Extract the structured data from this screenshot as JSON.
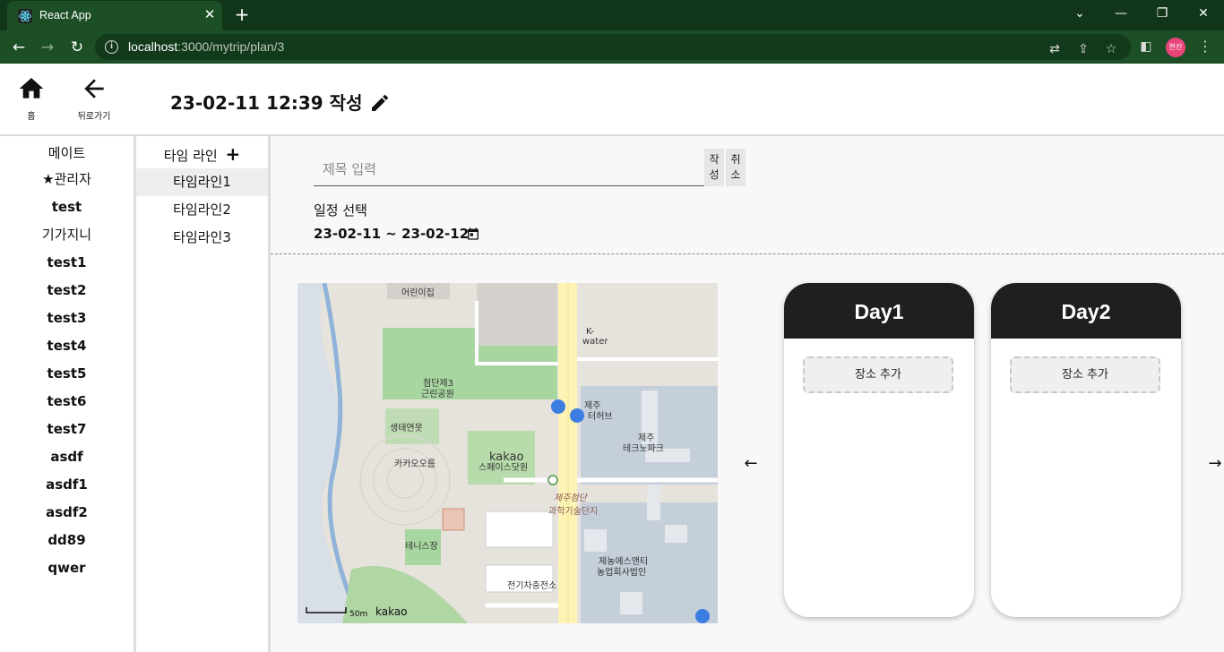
{
  "browser": {
    "tab_title": "React App",
    "url_host": "localhost",
    "url_rest": ":3000/mytrip/plan/3",
    "profile_initials": "현진"
  },
  "header": {
    "home_label": "홈",
    "back_label": "뒤로가기",
    "doc_title": "23-02-11 12:39 작성"
  },
  "mates": {
    "heading": "메이트",
    "items": [
      "★관리자",
      "test",
      "기가지니",
      "test1",
      "test2",
      "test3",
      "test4",
      "test5",
      "test6",
      "test7",
      "asdf",
      "asdf1",
      "asdf2",
      "dd89",
      "qwer"
    ]
  },
  "timelines": {
    "heading": "타임 라인",
    "items": [
      "타임라인1",
      "타임라인2",
      "타임라인3"
    ]
  },
  "form": {
    "title_placeholder": "제목 입력",
    "write_label": "작성",
    "cancel_label": "취소",
    "schedule_label": "일정 선택",
    "schedule_range": "23-02-11 ~ 23-02-12"
  },
  "map": {
    "labels": [
      "어린이집",
      "K-",
      "water",
      "첨단제3",
      "근린공원",
      "제주",
      "터허브",
      "생태연못",
      "제주",
      "테크노파크",
      "카카오오름",
      "kakao",
      "스페이스닷원",
      "제주첨단",
      "과학기술단지",
      "테니스장",
      "제농에스앤티",
      "농업회사법인",
      "전기차충전소"
    ],
    "scale": "50m",
    "brand": "kakao"
  },
  "days": [
    {
      "title": "Day1",
      "add_label": "장소 추가"
    },
    {
      "title": "Day2",
      "add_label": "장소 추가"
    }
  ],
  "colors": {
    "browser_frame": "#12361a",
    "toolbar": "#1d4f26",
    "day_header": "#1f1f1f",
    "active_timeline": "#eeeeee"
  }
}
